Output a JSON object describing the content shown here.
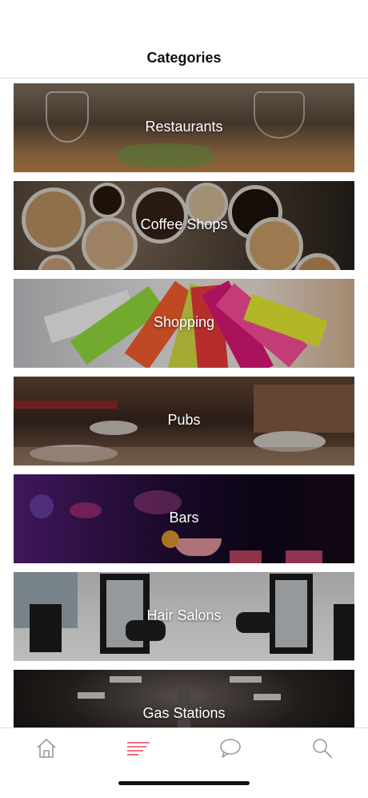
{
  "header": {
    "title": "Categories"
  },
  "categories": [
    {
      "label": "Restaurants",
      "colors": [
        "#6b5a45",
        "#3a2e22",
        "#c9a57a"
      ]
    },
    {
      "label": "Coffee Shops",
      "colors": [
        "#7a6a58",
        "#2b241e",
        "#d6b48a"
      ]
    },
    {
      "label": "Shopping",
      "colors": [
        "#cfcfd2",
        "#e23a3a",
        "#8bd03b"
      ]
    },
    {
      "label": "Pubs",
      "colors": [
        "#4a3226",
        "#1f1714",
        "#8a5a3a"
      ]
    },
    {
      "label": "Bars",
      "colors": [
        "#3a1050",
        "#0e0a22",
        "#e04aa0"
      ]
    },
    {
      "label": "Hair Salons",
      "colors": [
        "#d8d8d8",
        "#2a2a2a",
        "#9a9a9a"
      ]
    },
    {
      "label": "Gas Stations",
      "colors": [
        "#2a2320",
        "#0c0a0a",
        "#7a6a60"
      ]
    }
  ],
  "tab_bar": {
    "accent_color": "#e8455a",
    "icon_color": "#9a9a9a",
    "tabs": [
      {
        "name": "home",
        "icon": "home-icon"
      },
      {
        "name": "categories",
        "icon": "list-icon",
        "selected": true
      },
      {
        "name": "messages",
        "icon": "chat-bubble-icon"
      },
      {
        "name": "search",
        "icon": "search-icon"
      }
    ]
  }
}
